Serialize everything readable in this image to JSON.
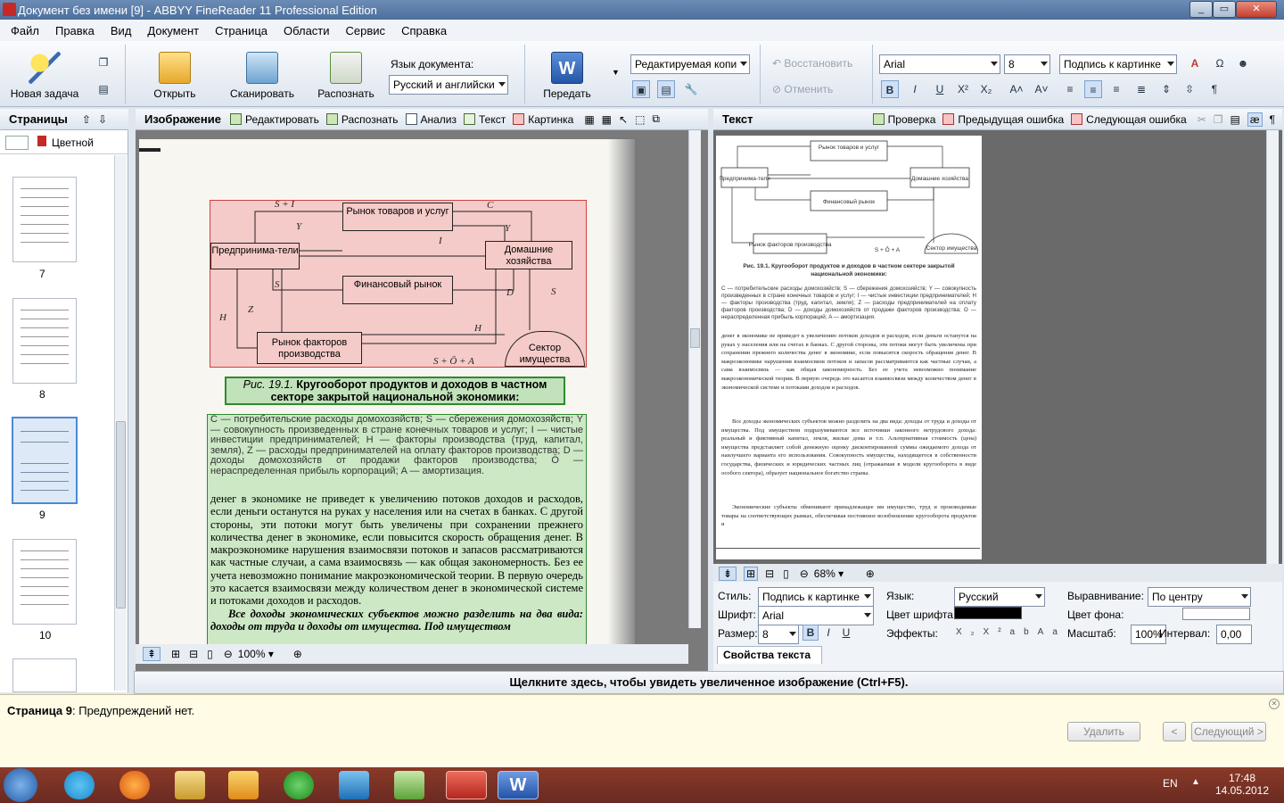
{
  "window": {
    "title": "Документ без имени [9] - ABBYY FineReader 11 Professional Edition"
  },
  "menu": [
    "Файл",
    "Правка",
    "Вид",
    "Документ",
    "Страница",
    "Области",
    "Сервис",
    "Справка"
  ],
  "ribbon": {
    "new_task": "Новая задача",
    "open": "Открыть",
    "scan": "Сканировать",
    "recognize": "Распознать",
    "doc_lang_label": "Язык документа:",
    "doc_lang_value": "Русский и английски",
    "send": "Передать",
    "save_mode": "Редактируемая копи",
    "restore": "Восстановить",
    "cancel": "Отменить",
    "font": "Arial",
    "size": "8",
    "style": "Подпись к картинке"
  },
  "pages_pane": {
    "title": "Страницы",
    "mode": "Цветной",
    "thumbs": [
      "7",
      "8",
      "9",
      "10"
    ]
  },
  "image_pane": {
    "title": "Изображение",
    "tools": [
      "Редактировать",
      "Распознать",
      "Анализ",
      "Текст",
      "Картинка"
    ],
    "zoom": "100%"
  },
  "text_pane": {
    "title": "Текст",
    "check": "Проверка",
    "prev_error": "Предыдущая ошибка",
    "next_error": "Следующая ошибка",
    "zoom": "68%",
    "page_number": "270"
  },
  "diagram": {
    "market_goods": "Рынок товаров и услуг",
    "entrepreneurs": "Предпринима-тели",
    "households": "Домашние хозяйства",
    "fin_market": "Финансовый рынок",
    "factor_market": "Рынок факторов производства",
    "property": "Сектор имущества",
    "labels": {
      "SI": "S + I",
      "C": "C",
      "Y1": "Y",
      "Y2": "Y",
      "I": "I",
      "S1": "S",
      "S2": "S",
      "D": "D",
      "Z": "Z",
      "H1": "H",
      "H2": "H",
      "SOA": "S + Ō + A"
    }
  },
  "caption": {
    "prefix": "Рис. 19.1.",
    "text": "Кругооборот продуктов и доходов в частном секторе закрытой национальной экономики:"
  },
  "legend": "С — потребительские расходы домохозяйств; S — сбережения домохозяйств; Y — совокупность произведенных в стране конечных товаров и услуг; I — чистые инвестиции предпринимателей; H — факторы производства (труд, капитал, земля), Z — расходы предпринимателей на оплату факторов производства; D — доходы домохозяйств от продажи факторов производства; Ō — нераспределенная прибыль корпораций; A — амортизация.",
  "body_text": "денег в экономике не приведет к увеличению потоков доходов и расходов, если деньги останутся на руках у населения или на счетах в банках. С другой стороны, эти потоки могут быть увеличены при сохранении прежнего количества денег в экономике, если повысится скорость обращения денег. В макроэкономике нарушения взаимосвязи потоков и запасов рассматриваются как частные случаи, а сама взаимосвязь — как общая закономерность. Без ее учета невозможно понимание макроэкономической теории. В первую очередь это касается взаимосвязи между количеством денег в экономической системе и потоками доходов и расходов.",
  "body_text2": "Все доходы экономических субъектов можно разделить на два вида: доходы от труда и доходы от имущества. Под имуществом",
  "text_page": {
    "caption": "Рис. 19.1. Кругооборот продуктов и доходов в частном секторе закрытой национальной экономики:",
    "legend": "С — потребительские расходы домохозяйств; S — сбережения домохозяйств; Y — совокупность произведенных в стране конечных товаров и услуг; I — чистые инвестиции предпринимателей; H — факторы производства (труд, капитал, земля); Z — расходы предпринимателей на оплату факторов производства; D — доходы домохозяйств от продажи факторов производства; O — нераспределенная прибыль корпораций; A — амортизация.",
    "para1": "денег в экономике не приведет к увеличению потоков доходов и расходов, если деньги останутся на руках у населения или на счетах в банках. С другой стороны, эти потоки могут быть увеличены при сохранении прежнего количества денег в экономике, если повысится скорость обращения денег. В макроэкономике нарушения взаимосвязи потоков и запасов рассматриваются как частные случаи, а сама взаимосвязь — как общая закономерность. Без ее учета невозможно понимание макроэкономической теории. В первую очередь это касается взаимосвязи между количеством денег в экономической системе и потоками доходов и расходов.",
    "para2": "Все доходы экономических субъектов можно разделить на два вида: доходы от труда и доходы от имущества. Под имуществом подразумеваются все источники законного нетрудового дохода: реальный и фиктивный капитал, земля, жилые дома и т.п. Альтернативная стоимость (цена) имущества представляет собой денежную оценку дисконтированной суммы ожидаемого дохода от наилучшего варианта его использования. Совокупность имущества, находящегося в собственности государства, физических и юридических частных лиц (отражаемая в модели кругооборота в виде особого сектора), образует национальное богатство страны.",
    "para3": "Экономические субъекты обменивают принадлежащее им имущество, труд и производимые товары на соответствующих рынках, обеспечивая постоянное возобновление кругооборота продуктов и"
  },
  "props": {
    "style_label": "Стиль:",
    "style_value": "Подпись к картинке",
    "lang_label": "Язык:",
    "lang_value": "Русский",
    "align_label": "Выравнивание:",
    "align_value": "По центру",
    "font_label": "Шрифт:",
    "font_value": "Arial",
    "color_label": "Цвет шрифта:",
    "bg_label": "Цвет фона:",
    "size_label": "Размер:",
    "size_value": "8",
    "effects_label": "Эффекты:",
    "scale_label": "Масштаб:",
    "scale_value": "100%",
    "interval_label": "Интервал:",
    "interval_value": "0,00",
    "tab": "Свойства текста"
  },
  "bottom_hint": "Щелкните здесь, чтобы увидеть увеличенное изображение (Ctrl+F5).",
  "warnings": {
    "page": "Страница 9",
    "msg": ": Предупреждений нет.",
    "delete": "Удалить",
    "prev": "<",
    "next": "Следующий >"
  },
  "tray": {
    "lang": "EN",
    "time": "17:48",
    "date": "14.05.2012"
  }
}
